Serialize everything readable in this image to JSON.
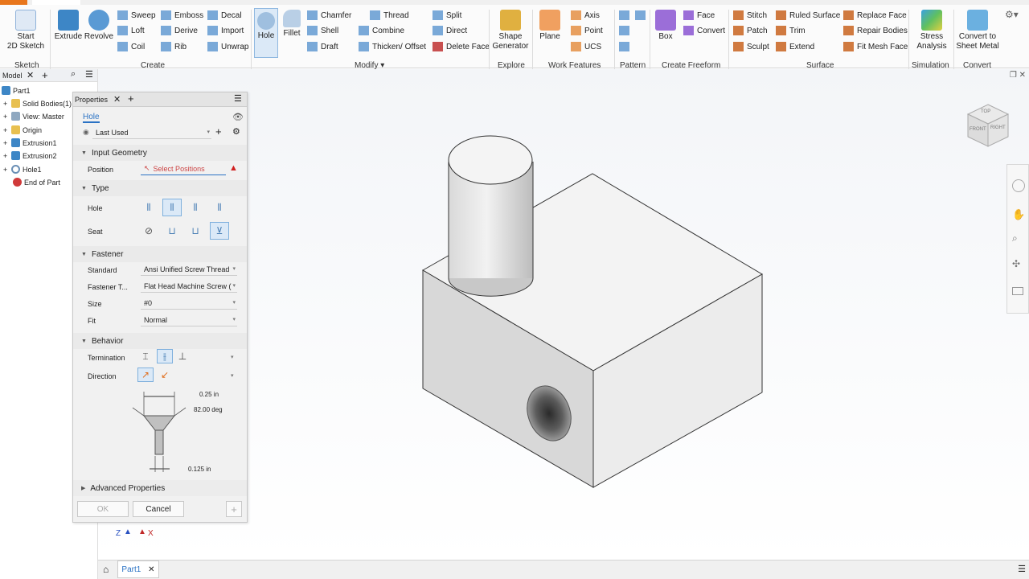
{
  "window": {
    "title": "Part1"
  },
  "ribbon": {
    "sketch": {
      "start": "Start",
      "sketch2d": "2D Sketch",
      "panel": "Sketch"
    },
    "create": {
      "extrude": "Extrude",
      "revolve": "Revolve",
      "sweep": "Sweep",
      "emboss": "Emboss",
      "decal": "Decal",
      "loft": "Loft",
      "derive": "Derive",
      "import": "Import",
      "coil": "Coil",
      "rib": "Rib",
      "unwrap": "Unwrap",
      "panel": "Create"
    },
    "modify": {
      "hole": "Hole",
      "fillet": "Fillet",
      "chamfer": "Chamfer",
      "thread": "Thread",
      "split": "Split",
      "shell": "Shell",
      "combine": "Combine",
      "direct": "Direct",
      "draft": "Draft",
      "thicken": "Thicken/ Offset",
      "delete_face": "Delete Face",
      "panel": "Modify ▾"
    },
    "explore": {
      "shape_generator": "Shape Generator",
      "panel": "Explore"
    },
    "work": {
      "plane": "Plane",
      "axis": "Axis",
      "point": "Point",
      "ucs": "UCS",
      "panel": "Work Features"
    },
    "pattern": {
      "panel": "Pattern"
    },
    "freeform": {
      "box": "Box",
      "face": "Face",
      "convert": "Convert",
      "panel": "Create Freeform"
    },
    "surface": {
      "stitch": "Stitch",
      "ruled": "Ruled Surface",
      "replace": "Replace Face",
      "patch": "Patch",
      "trim": "Trim",
      "repair": "Repair Bodies",
      "sculpt": "Sculpt",
      "extend": "Extend",
      "fitmesh": "Fit Mesh Face",
      "panel": "Surface"
    },
    "simulation": {
      "stress": "Stress Analysis",
      "panel": "Simulation"
    },
    "convert": {
      "sheet": "Convert to Sheet Metal",
      "panel": "Convert"
    }
  },
  "browser": {
    "tab": "Model",
    "items": [
      "Part1",
      "Solid Bodies(1)",
      "View: Master",
      "Origin",
      "Extrusion1",
      "Extrusion2",
      "Hole1",
      "End of Part"
    ]
  },
  "properties": {
    "title": "Properties",
    "feature": "Hole",
    "preset": "Last Used",
    "input_geometry": "Input Geometry",
    "position_label": "Position",
    "position_value": "Select Positions",
    "type": "Type",
    "hole_label": "Hole",
    "seat_label": "Seat",
    "fastener": "Fastener",
    "standard_label": "Standard",
    "standard_value": "Ansi Unified Screw Thread",
    "fastener_type_label": "Fastener T...",
    "fastener_type_value": "Flat Head Machine Screw (",
    "size_label": "Size",
    "size_value": "#0",
    "fit_label": "Fit",
    "fit_value": "Normal",
    "behavior": "Behavior",
    "termination_label": "Termination",
    "direction_label": "Direction",
    "dim1": "0.25 in",
    "dim2": "82.00 deg",
    "dim3": "0.125 in",
    "advanced": "Advanced Properties",
    "ok": "OK",
    "cancel": "Cancel"
  },
  "viewcube": {
    "top": "TOP",
    "front": "FRONT",
    "right": "RIGHT"
  },
  "triad": {
    "z": "Z",
    "x": "X"
  },
  "doc_tab": "Part1"
}
